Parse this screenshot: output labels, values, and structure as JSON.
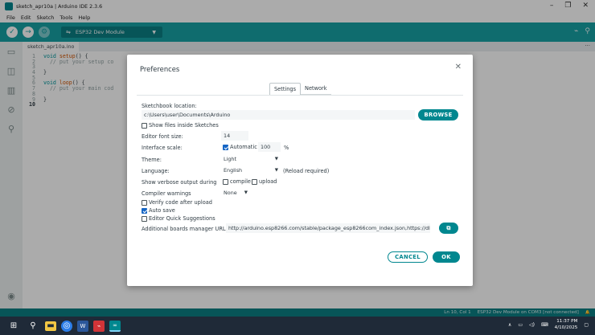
{
  "window": {
    "title": "sketch_apr10a | Arduino IDE 2.3.6",
    "minimize_glyph": "–",
    "maximize_glyph": "❐",
    "close_glyph": "✕"
  },
  "menu": [
    "File",
    "Edit",
    "Sketch",
    "Tools",
    "Help"
  ],
  "toolbar": {
    "board": "ESP32 Dev Module",
    "verify_glyph": "✓",
    "upload_glyph": "→",
    "debug_glyph": "⚙",
    "serial_plotter_glyph": "⌁",
    "serial_monitor_glyph": "⚲"
  },
  "editor": {
    "file_tab": "sketch_apr10a.ino",
    "more_glyph": "···",
    "lines": [
      {
        "n": "1",
        "kw": "void ",
        "fn": "setup",
        "rest": "() {",
        "cm": ""
      },
      {
        "n": "2",
        "kw": "",
        "fn": "",
        "rest": "",
        "cm": "  // put your setup co"
      },
      {
        "n": "3",
        "kw": "",
        "fn": "",
        "rest": "",
        "cm": ""
      },
      {
        "n": "4",
        "kw": "",
        "fn": "",
        "rest": "}",
        "cm": ""
      },
      {
        "n": "5",
        "kw": "",
        "fn": "",
        "rest": "",
        "cm": ""
      },
      {
        "n": "6",
        "kw": "void ",
        "fn": "loop",
        "rest": "() {",
        "cm": ""
      },
      {
        "n": "7",
        "kw": "",
        "fn": "",
        "rest": "",
        "cm": "  // put your main cod"
      },
      {
        "n": "8",
        "kw": "",
        "fn": "",
        "rest": "",
        "cm": ""
      },
      {
        "n": "9",
        "kw": "",
        "fn": "",
        "rest": "}",
        "cm": ""
      },
      {
        "n": "10",
        "kw": "",
        "fn": "",
        "rest": "",
        "cm": ""
      }
    ]
  },
  "status": {
    "position": "Ln 10, Col 1",
    "board_port": "ESP32 Dev Module on COM3 [not connected]",
    "bell_glyph": "🔔"
  },
  "taskbar": {
    "time": "11:37 PM",
    "date": "4/10/2025"
  },
  "dialog": {
    "title": "Preferences",
    "close_glyph": "✕",
    "tabs": [
      "Settings",
      "Network"
    ],
    "sketchbook_label": "Sketchbook location:",
    "sketchbook_value": "c:\\Users\\user\\Documents\\Arduino",
    "browse_label": "BROWSE",
    "show_files_label": "Show files inside Sketches",
    "font_size_label": "Editor font size:",
    "font_size_value": "14",
    "scale_label": "Interface scale:",
    "scale_auto_label": "Automatic",
    "scale_value": "100",
    "scale_unit": "%",
    "theme_label": "Theme:",
    "theme_value": "Light",
    "language_label": "Language:",
    "language_value": "English",
    "language_note": "(Reload required)",
    "verbose_label": "Show verbose output during",
    "verbose_compile": "compile",
    "verbose_upload": "upload",
    "warnings_label": "Compiler warnings",
    "warnings_value": "None",
    "verify_label": "Verify code after upload",
    "autosave_label": "Auto save",
    "quick_suggestions_label": "Editor Quick Suggestions",
    "boards_url_label": "Additional boards manager URLs:",
    "boards_url_value": "http://arduino.esp8266.com/stable/package_esp8266com_index.json,https://dl....",
    "cancel_label": "CANCEL",
    "ok_label": "OK",
    "checked": {
      "show_files": false,
      "scale_auto": true,
      "verbose_compile": false,
      "verbose_upload": false,
      "verify": false,
      "autosave": true,
      "quick_suggestions": false
    }
  },
  "colors": {
    "accent": "#00878f",
    "toolbar": "#17a1a5",
    "statusbar": "#0b7f84"
  }
}
